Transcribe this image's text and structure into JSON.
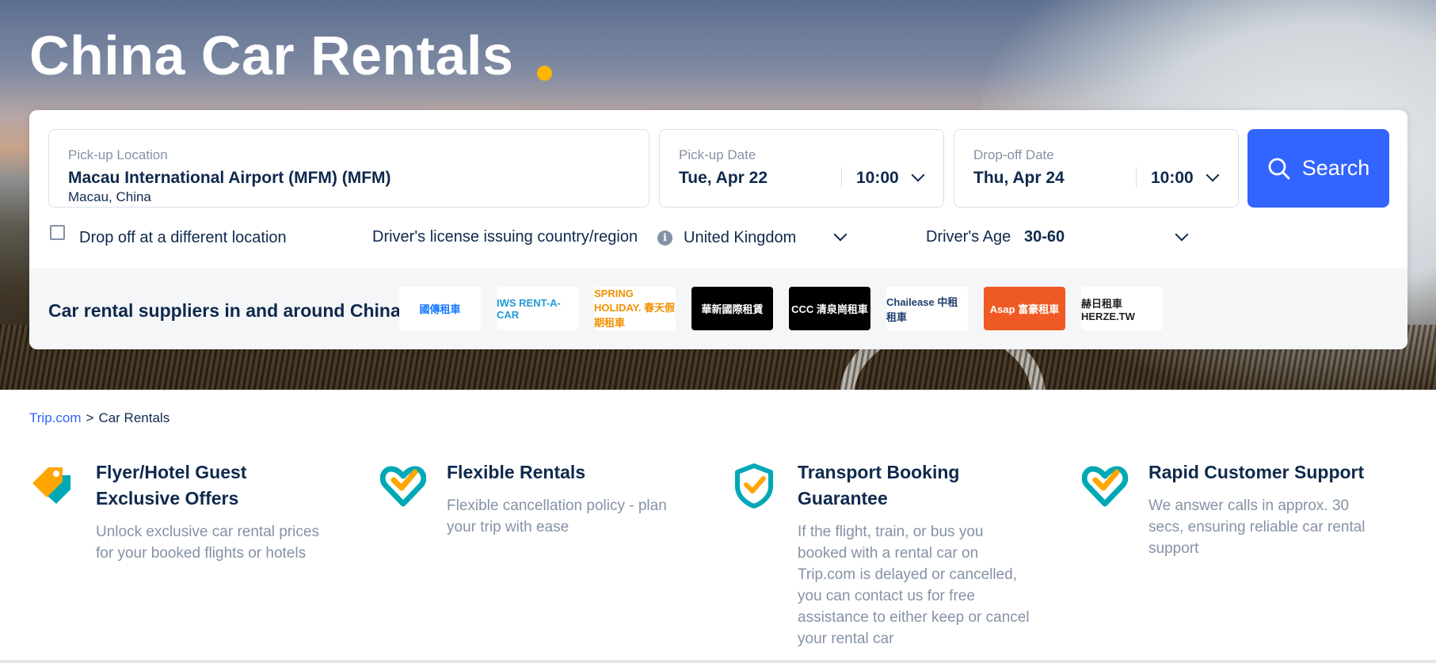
{
  "hero": {
    "title": "China Car Rentals"
  },
  "search": {
    "pickup_location": {
      "label": "Pick-up Location",
      "value": "Macau International Airport (MFM) (MFM)",
      "sub": "Macau, China"
    },
    "pickup_date": {
      "label": "Pick-up Date",
      "date": "Tue, Apr 22",
      "time": "10:00"
    },
    "dropoff_date": {
      "label": "Drop-off Date",
      "date": "Thu, Apr 24",
      "time": "10:00"
    },
    "search_label": "Search"
  },
  "options": {
    "different_location": "Drop off at a different location",
    "license_label": "Driver's license issuing country/region",
    "license_value": "United Kingdom",
    "age_label": "Driver's Age",
    "age_value": "30-60"
  },
  "suppliers": {
    "title": "Car rental suppliers in and around China",
    "logos": [
      {
        "text": "國傳租車",
        "color": "#1677ff",
        "bg": "#ffffff"
      },
      {
        "text": "IWS RENT-A-CAR",
        "color": "#1f9ad6",
        "bg": "#ffffff"
      },
      {
        "text": "SPRING HOLIDAY. 春天假期租車",
        "color": "#f29100",
        "bg": "#ffffff"
      },
      {
        "text": "華新國際租賃",
        "color": "#ffffff",
        "bg": "#000000"
      },
      {
        "text": "CCC 清泉崗租車",
        "color": "#ffffff",
        "bg": "#000000"
      },
      {
        "text": "Chailease 中租租車",
        "color": "#1f3f6e",
        "bg": "#ffffff"
      },
      {
        "text": "Asap 富豪租車",
        "color": "#ffffff",
        "bg": "#ef5a24"
      },
      {
        "text": "赫日租車 HERZE.TW",
        "color": "#222222",
        "bg": "#ffffff"
      }
    ]
  },
  "breadcrumb": {
    "home": "Trip.com",
    "separator": ">",
    "current": "Car Rentals"
  },
  "features": [
    {
      "icon": "price-tag-icon",
      "title": "Flyer/Hotel Guest Exclusive Offers",
      "desc": "Unlock exclusive car rental prices for your booked flights or hotels"
    },
    {
      "icon": "heart-check-icon",
      "title": "Flexible Rentals",
      "desc": "Flexible cancellation policy - plan your trip with ease"
    },
    {
      "icon": "shield-check-icon",
      "title": "Transport Booking Guarantee",
      "desc": "If the flight, train, or bus you booked with a rental car on Trip.com is delayed or cancelled, you can contact us for free assistance to either keep or cancel your rental car"
    },
    {
      "icon": "heart-check-icon",
      "title": "Rapid Customer Support",
      "desc": "We answer calls in approx. 30 secs, ensuring reliable car rental support"
    }
  ],
  "colors": {
    "brand_blue": "#3264ff",
    "accent_yellow": "#ffb400",
    "icon_teal": "#00a8b5",
    "icon_orange": "#ffa600",
    "text_dark": "#0f294d",
    "text_muted": "#8592a6"
  }
}
